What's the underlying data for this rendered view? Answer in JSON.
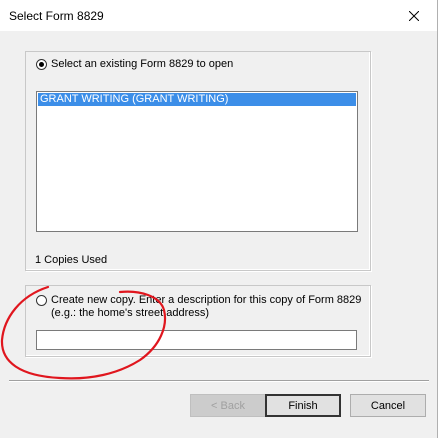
{
  "window": {
    "title": "Select Form 8829"
  },
  "existing": {
    "radio_label": "Select an existing Form 8829 to open",
    "selected": true,
    "items": [
      "GRANT WRITING (GRANT WRITING)"
    ],
    "copies_used": "1 Copies Used"
  },
  "new_copy": {
    "radio_label_line1": "Create new copy.  Enter a description for this copy of Form 8829",
    "radio_label_line2": "(e.g.: the home's street address)",
    "selected": false,
    "input_value": ""
  },
  "buttons": {
    "back": "< Back",
    "finish": "Finish",
    "cancel": "Cancel"
  },
  "colors": {
    "selection": "#3c8ee8",
    "annotation_stroke": "#e0161e"
  }
}
